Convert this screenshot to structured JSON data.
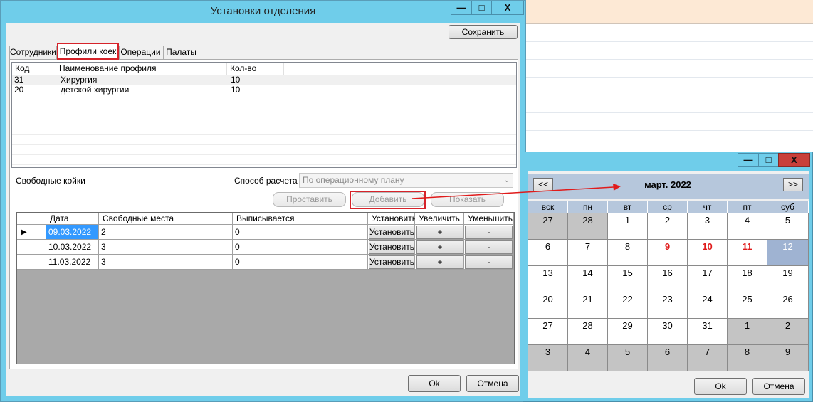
{
  "main_window": {
    "title": "Установки отделения",
    "controls": {
      "minimize": "—",
      "maximize": "□",
      "close": "X"
    },
    "save_label": "Сохранить",
    "tabs": [
      {
        "label": "Сотрудники",
        "active": false
      },
      {
        "label": "Профили коек",
        "active": true
      },
      {
        "label": "Операции",
        "active": false
      },
      {
        "label": "Палаты",
        "active": false
      }
    ],
    "profiles": {
      "columns": [
        "Код",
        "Наименование профиля",
        "Кол-во"
      ],
      "rows": [
        {
          "code": "31",
          "name": "Хирургия",
          "count": "10"
        },
        {
          "code": "20",
          "name": "детской хирургии",
          "count": "10"
        }
      ]
    },
    "free_beds_label": "Свободные койки",
    "calc_method_label": "Способ расчета",
    "calc_method_value": "По операционному плану",
    "buttons": {
      "set": "Проставить",
      "add": "Добавить",
      "show": "Показать"
    },
    "grid": {
      "columns": [
        "Дата",
        "Свободные места",
        "Выписывается",
        "Установить",
        "Увеличить",
        "Уменьшить"
      ],
      "rows": [
        {
          "date": "09.03.2022",
          "free": "2",
          "discharged": "0",
          "set": "Установить",
          "inc": "+",
          "dec": "-"
        },
        {
          "date": "10.03.2022",
          "free": "3",
          "discharged": "0",
          "set": "Установить",
          "inc": "+",
          "dec": "-"
        },
        {
          "date": "11.03.2022",
          "free": "3",
          "discharged": "0",
          "set": "Установить",
          "inc": "+",
          "dec": "-"
        }
      ],
      "current_row_marker": "▶"
    },
    "ok_label": "Ok",
    "cancel_label": "Отмена"
  },
  "calendar_window": {
    "controls": {
      "minimize": "—",
      "maximize": "□",
      "close": "X"
    },
    "month_label": "март. 2022",
    "prev_label": "<<",
    "next_label": ">>",
    "weekdays": [
      "вск",
      "пн",
      "вт",
      "ср",
      "чт",
      "пт",
      "суб"
    ],
    "weeks": [
      [
        {
          "d": "27",
          "other": true
        },
        {
          "d": "28",
          "other": true
        },
        {
          "d": "1"
        },
        {
          "d": "2"
        },
        {
          "d": "3"
        },
        {
          "d": "4"
        },
        {
          "d": "5"
        }
      ],
      [
        {
          "d": "6"
        },
        {
          "d": "7"
        },
        {
          "d": "8"
        },
        {
          "d": "9",
          "holiday": true
        },
        {
          "d": "10",
          "holiday": true
        },
        {
          "d": "11",
          "holiday": true
        },
        {
          "d": "12",
          "today": true
        }
      ],
      [
        {
          "d": "13"
        },
        {
          "d": "14"
        },
        {
          "d": "15"
        },
        {
          "d": "16"
        },
        {
          "d": "17"
        },
        {
          "d": "18"
        },
        {
          "d": "19"
        }
      ],
      [
        {
          "d": "20"
        },
        {
          "d": "21"
        },
        {
          "d": "22"
        },
        {
          "d": "23"
        },
        {
          "d": "24"
        },
        {
          "d": "25"
        },
        {
          "d": "26"
        }
      ],
      [
        {
          "d": "27"
        },
        {
          "d": "28"
        },
        {
          "d": "29"
        },
        {
          "d": "30"
        },
        {
          "d": "31"
        },
        {
          "d": "1",
          "other": true
        },
        {
          "d": "2",
          "other": true
        }
      ],
      [
        {
          "d": "3",
          "other": true
        },
        {
          "d": "4",
          "other": true
        },
        {
          "d": "5",
          "other": true
        },
        {
          "d": "6",
          "other": true
        },
        {
          "d": "7",
          "other": true
        },
        {
          "d": "8",
          "other": true
        },
        {
          "d": "9",
          "other": true
        }
      ]
    ],
    "ok_label": "Ok",
    "cancel_label": "Отмена"
  },
  "colors": {
    "title_bar": "#6fcdea",
    "highlight": "#d6232a",
    "holiday": "#e01b1b",
    "selected_date": "#9fb3d2"
  }
}
